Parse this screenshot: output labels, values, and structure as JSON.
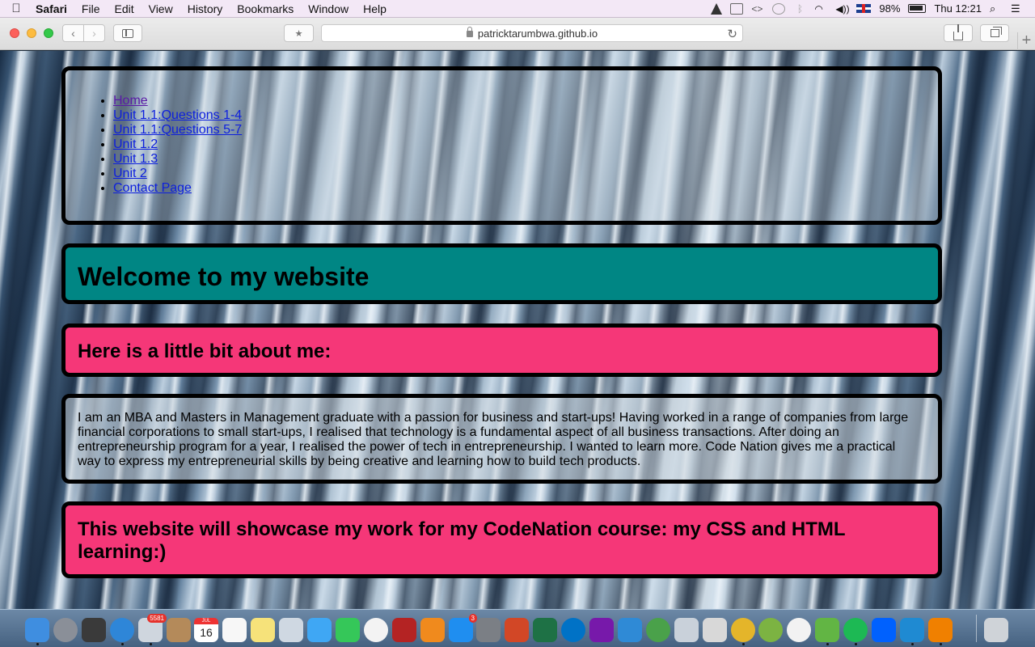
{
  "menubar": {
    "app_name": "Safari",
    "menus": [
      "File",
      "Edit",
      "View",
      "History",
      "Bookmarks",
      "Window",
      "Help"
    ],
    "battery": "98%",
    "clock": "Thu 12:21"
  },
  "browser": {
    "url": "patricktarumbwa.github.io",
    "favorites_glyph": "★"
  },
  "site": {
    "nav_links": [
      {
        "label": "Home",
        "visited": true
      },
      {
        "label": "Unit 1.1:Questions 1-4",
        "visited": false
      },
      {
        "label": "Unit 1.1:Questions 5-7",
        "visited": false
      },
      {
        "label": "Unit 1.2",
        "visited": false
      },
      {
        "label": "Unit 1.3",
        "visited": false
      },
      {
        "label": "Unit 2",
        "visited": false
      },
      {
        "label": "Contact Page",
        "visited": false
      }
    ],
    "welcome_heading": "Welcome to my website",
    "about_heading": "Here is a little bit about me:",
    "bio": "I am an MBA and Masters in Management graduate with a passion for business and start-ups! Having worked in a range of companies from large financial corporations to small start-ups, I realised that technology is a fundamental aspect of all business transactions. After doing an entrepreneurship program for a year, I realised the power of tech in entrepreneurship. I wanted to learn more. Code Nation gives me a practical way to express my entrepreneurial skills by being creative and learning how to build tech products.",
    "showcase_heading": "This website will showcase my work for my CodeNation course: my CSS and HTML learning:)",
    "colors": {
      "welcome_bg": "#008684",
      "pink_bg": "#f53778",
      "link": "#0d1fdd",
      "visited_link": "#5a1aa6"
    }
  },
  "dock": {
    "mail_badge": "5581",
    "calendar_month": "JUL",
    "calendar_day": "16",
    "appstore_badge": "3",
    "apps": [
      {
        "name": "finder-icon",
        "color": "#3f8ee0",
        "running": true
      },
      {
        "name": "launchpad-icon",
        "color": "#8a8f98",
        "running": false
      },
      {
        "name": "mission-control-icon",
        "color": "#3a3a3a",
        "running": false
      },
      {
        "name": "safari-icon",
        "color": "#2e86d8",
        "running": true
      },
      {
        "name": "mail-icon",
        "color": "#cfd6de",
        "running": true
      },
      {
        "name": "contacts-icon",
        "color": "#b48a5a",
        "running": false
      },
      {
        "name": "calendar-icon",
        "color": "#ffffff",
        "running": false
      },
      {
        "name": "reminders-icon",
        "color": "#f7f7f7",
        "running": false
      },
      {
        "name": "notes-icon",
        "color": "#f6e27a",
        "running": false
      },
      {
        "name": "preview-icon",
        "color": "#cfd8e2",
        "running": false
      },
      {
        "name": "messages-icon",
        "color": "#3fa7f4",
        "running": false
      },
      {
        "name": "facetime-icon",
        "color": "#35c759",
        "running": false
      },
      {
        "name": "photos-icon",
        "color": "#f3f3f3",
        "running": false
      },
      {
        "name": "photo-booth-icon",
        "color": "#b42323",
        "running": false
      },
      {
        "name": "ibooks-icon",
        "color": "#f08a1d",
        "running": false
      },
      {
        "name": "app-store-icon",
        "color": "#1f8ef0",
        "running": false
      },
      {
        "name": "system-preferences-icon",
        "color": "#7b7f85",
        "running": false
      },
      {
        "name": "powerpoint-icon",
        "color": "#d24726",
        "running": false
      },
      {
        "name": "excel-icon",
        "color": "#1e7145",
        "running": false
      },
      {
        "name": "outlook-icon",
        "color": "#0072c6",
        "running": false
      },
      {
        "name": "onenote-icon",
        "color": "#7719aa",
        "running": false
      },
      {
        "name": "lync-icon",
        "color": "#2f8ad6",
        "running": false
      },
      {
        "name": "network-icon",
        "color": "#4aa14a",
        "running": false
      },
      {
        "name": "satellite-icon",
        "color": "#c9d1da",
        "running": false
      },
      {
        "name": "solution-icon",
        "color": "#d8d8d8",
        "running": false
      },
      {
        "name": "chrome-icon",
        "color": "#e4b52a",
        "running": true
      },
      {
        "name": "qgis-icon",
        "color": "#7cb342",
        "running": false
      },
      {
        "name": "itunes-icon",
        "color": "#f2f2f2",
        "running": false
      },
      {
        "name": "utorrent-icon",
        "color": "#62b544",
        "running": true
      },
      {
        "name": "spotify-icon",
        "color": "#1db954",
        "running": true
      },
      {
        "name": "dropbox-icon",
        "color": "#0061fe",
        "running": false
      },
      {
        "name": "vscode-icon",
        "color": "#1f8ad2",
        "running": true
      },
      {
        "name": "vlc-icon",
        "color": "#f08000",
        "running": true
      }
    ],
    "trash": {
      "name": "trash-icon",
      "color": "#cfd3d8"
    }
  }
}
